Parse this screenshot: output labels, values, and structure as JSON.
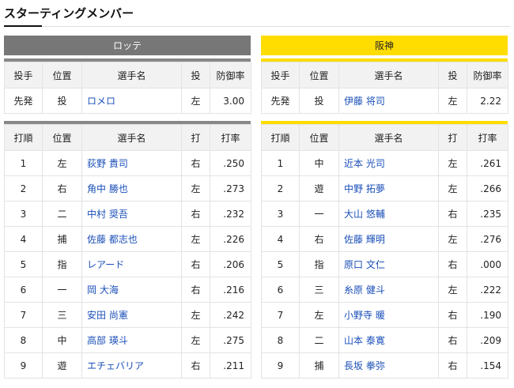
{
  "page": {
    "title": "スターティングメンバー"
  },
  "teams": {
    "lotte": {
      "name": "ロッテ",
      "color": "#777777"
    },
    "hanshin": {
      "name": "阪神",
      "color": "#ffdd00"
    }
  },
  "pitcher_headers": [
    "投手",
    "位置",
    "選手名",
    "投",
    "防御率"
  ],
  "batter_headers": [
    "打順",
    "位置",
    "選手名",
    "打",
    "打率"
  ],
  "lotte_pitcher": {
    "role": "先発",
    "pos": "投",
    "name": "ロメロ",
    "hand": "左",
    "era": "3.00"
  },
  "hanshin_pitcher": {
    "role": "先発",
    "pos": "投",
    "name": "伊藤 将司",
    "hand": "左",
    "era": "2.22"
  },
  "lotte_batters": [
    {
      "order": "1",
      "pos": "左",
      "name": "荻野 貴司",
      "hand": "右",
      "avg": ".250"
    },
    {
      "order": "2",
      "pos": "右",
      "name": "角中 勝也",
      "hand": "左",
      "avg": ".273"
    },
    {
      "order": "3",
      "pos": "二",
      "name": "中村 奨吾",
      "hand": "右",
      "avg": ".232"
    },
    {
      "order": "4",
      "pos": "捕",
      "name": "佐藤 都志也",
      "hand": "左",
      "avg": ".226"
    },
    {
      "order": "5",
      "pos": "指",
      "name": "レアード",
      "hand": "右",
      "avg": ".206"
    },
    {
      "order": "6",
      "pos": "一",
      "name": "岡 大海",
      "hand": "右",
      "avg": ".216"
    },
    {
      "order": "7",
      "pos": "三",
      "name": "安田 尚憲",
      "hand": "左",
      "avg": ".242"
    },
    {
      "order": "8",
      "pos": "中",
      "name": "高部 瑛斗",
      "hand": "左",
      "avg": ".275"
    },
    {
      "order": "9",
      "pos": "遊",
      "name": "エチェバリア",
      "hand": "右",
      "avg": ".211"
    }
  ],
  "hanshin_batters": [
    {
      "order": "1",
      "pos": "中",
      "name": "近本 光司",
      "hand": "左",
      "avg": ".261"
    },
    {
      "order": "2",
      "pos": "遊",
      "name": "中野 拓夢",
      "hand": "左",
      "avg": ".266"
    },
    {
      "order": "3",
      "pos": "一",
      "name": "大山 悠輔",
      "hand": "右",
      "avg": ".235"
    },
    {
      "order": "4",
      "pos": "右",
      "name": "佐藤 輝明",
      "hand": "左",
      "avg": ".276"
    },
    {
      "order": "5",
      "pos": "指",
      "name": "原口 文仁",
      "hand": "右",
      "avg": ".000"
    },
    {
      "order": "6",
      "pos": "三",
      "name": "糸原 健斗",
      "hand": "左",
      "avg": ".222"
    },
    {
      "order": "7",
      "pos": "左",
      "name": "小野寺 暖",
      "hand": "右",
      "avg": ".190"
    },
    {
      "order": "8",
      "pos": "二",
      "name": "山本 泰寛",
      "hand": "右",
      "avg": ".209"
    },
    {
      "order": "9",
      "pos": "捕",
      "name": "長坂 拳弥",
      "hand": "右",
      "avg": ".154"
    }
  ]
}
